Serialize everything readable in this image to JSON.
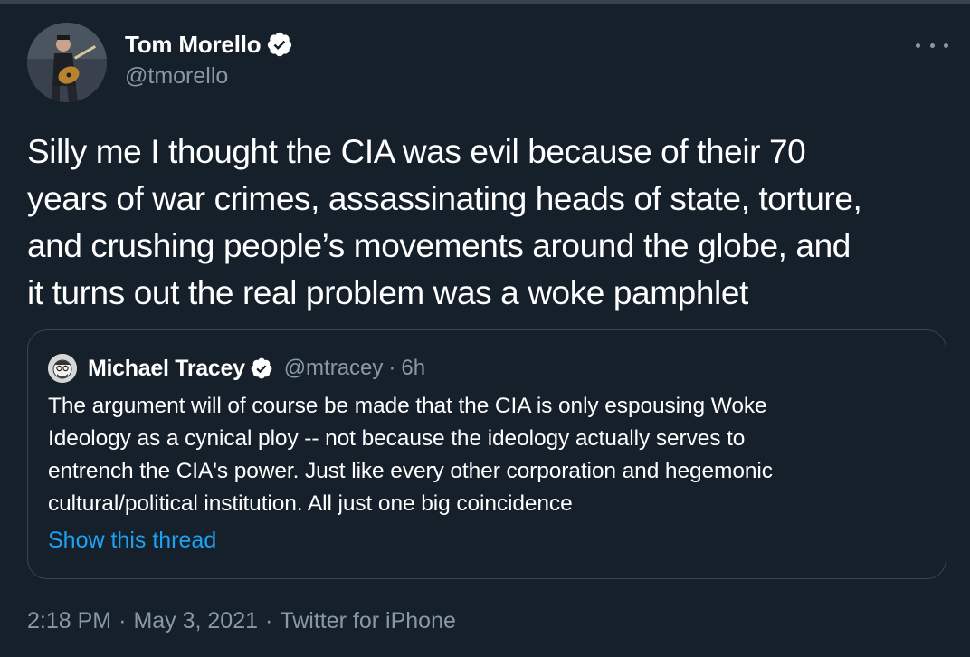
{
  "author": {
    "display_name": "Tom Morello",
    "handle": "@tmorello",
    "verified": true,
    "avatar_icon": "guitarist-photo"
  },
  "tweet": {
    "text_lines": [
      "Silly me I thought the CIA was evil because of their 70",
      "years of war crimes, assassinating heads of state, torture,",
      "and crushing people’s movements around the globe, and",
      "it turns out the real problem was a woke pamphlet"
    ]
  },
  "quoted_tweet": {
    "display_name": "Michael Tracey",
    "handle": "@mtracey",
    "separator": "·",
    "time": "6h",
    "verified": true,
    "text_lines": [
      "The argument will of course be made that the CIA is only espousing Woke",
      "Ideology as a cynical ploy -- not because the ideology actually serves to",
      "entrench the CIA's power. Just like every other corporation and hegemonic",
      "cultural/political institution. All just one big coincidence"
    ],
    "show_thread_label": "Show this thread"
  },
  "footer": {
    "time": "2:18 PM",
    "separator": "·",
    "date": "May 3, 2021",
    "source": "Twitter for iPhone"
  },
  "colors": {
    "background": "#15202b",
    "text": "#ffffff",
    "secondary": "#8899a6",
    "accent": "#1da1f2",
    "border": "#38444d"
  }
}
